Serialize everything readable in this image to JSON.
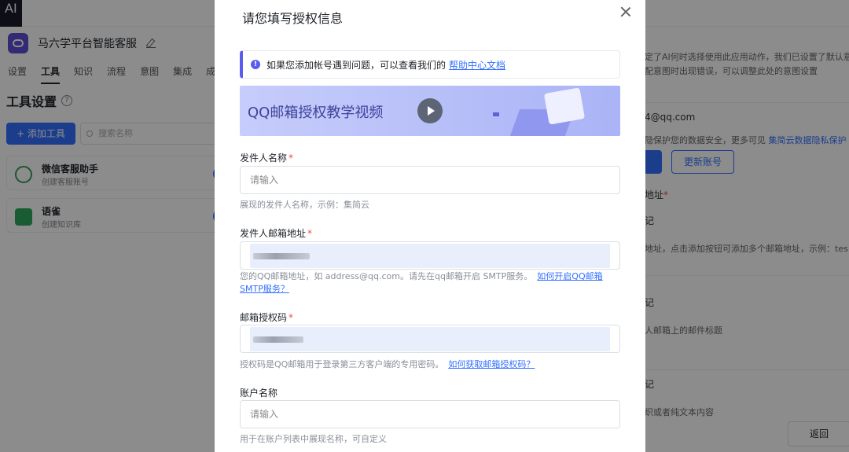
{
  "background": {
    "brand": "AI",
    "app_name": "马六学平台智能客服",
    "nav_tabs": [
      "设置",
      "工具",
      "知识",
      "流程",
      "意图",
      "集成",
      "成"
    ],
    "section_title": "工具设置",
    "help_symbol": "?",
    "add_tool_label": "+ 添加工具",
    "search_placeholder": "搜索名称",
    "tools": [
      {
        "name": "微信客服助手",
        "sub": "创建客服账号"
      },
      {
        "name": "语雀",
        "sub": "创建知识库"
      }
    ],
    "right_panel": {
      "desc_line1": "定了AI何时选择使用此应用动作，我们已设置了默认意",
      "desc_line2": "配意图时出现错误，可以调整此处的意图设置",
      "email": "4@qq.com",
      "note_text": "隐保护您的数据安全，更多可见 ",
      "note_link": "集简云数据隐私保护",
      "update_button": "更新账号",
      "label_address": "地址",
      "label_1": "记",
      "help_address": "地址，点击添加按钮可添加多个邮箱地址，示例：tes",
      "label_2": "记",
      "help_title": "人邮箱上的邮件标题",
      "label_3": "记",
      "help_partial": "织或者纯文本内容",
      "back_button": "返回"
    }
  },
  "modal": {
    "title": "请您填写授权信息",
    "notice_text": "如果您添加帐号遇到问题，可以查看我们的",
    "notice_link": "帮助中心文档",
    "banner_text": "QQ邮箱授权教学视频",
    "required_mark": "*",
    "info_symbol": "!",
    "fields": [
      {
        "label": "发件人名称",
        "required": true,
        "placeholder": "请输入",
        "help": "展现的发件人名称，示例：集简云",
        "help_link": ""
      },
      {
        "label": "发件人邮箱地址",
        "required": true,
        "placeholder": "",
        "help": "您的QQ邮箱地址，如 address@qq.com。请先在qq邮箱开启 SMTP服务。",
        "help_link": "如何开启QQ邮箱SMTP服务？"
      },
      {
        "label": "邮箱授权码",
        "required": true,
        "placeholder": "",
        "help": "授权码是QQ邮箱用于登录第三方客户端的专用密码。",
        "help_link": "如何获取邮箱授权码？"
      },
      {
        "label": "账户名称",
        "required": false,
        "placeholder": "请输入",
        "help": "用于在账户列表中展现名称，可自定义",
        "help_link": ""
      }
    ]
  }
}
